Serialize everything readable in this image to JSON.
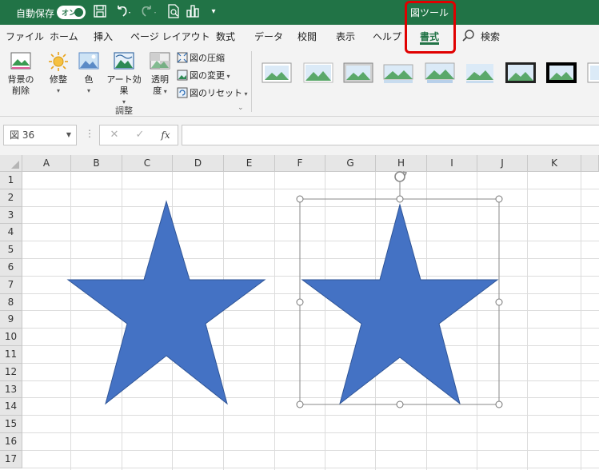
{
  "titlebar": {
    "autosave_label": "自動保存",
    "toggle_label": "オン",
    "context_tab_label": "図ツール"
  },
  "tabs": [
    {
      "label": "ファイル"
    },
    {
      "label": "ホーム"
    },
    {
      "label": "挿入"
    },
    {
      "label": "ページ レイアウト"
    },
    {
      "label": "数式"
    },
    {
      "label": "データ"
    },
    {
      "label": "校閲"
    },
    {
      "label": "表示"
    },
    {
      "label": "ヘルプ"
    },
    {
      "label": "書式"
    },
    {
      "label": "検索"
    }
  ],
  "ribbon": {
    "remove_bg_line1": "背景の",
    "remove_bg_line2": "削除",
    "corrections": "修整",
    "color": "色",
    "artistic_effects": "アート効果",
    "transparency_line1": "透明",
    "transparency_line2": "度",
    "compress": "図の圧縮",
    "change": "図の変更",
    "reset": "図のリセット",
    "group_label": "調整"
  },
  "formula_bar": {
    "name_box": "図 36",
    "cancel": "✕",
    "enter": "✓",
    "function": "fx",
    "value": ""
  },
  "grid": {
    "columns": [
      "A",
      "B",
      "C",
      "D",
      "E",
      "F",
      "G",
      "H",
      "I",
      "J",
      "K"
    ],
    "rows": [
      "1",
      "2",
      "3",
      "4",
      "5",
      "6",
      "7",
      "8",
      "9",
      "10",
      "11",
      "12",
      "13",
      "14",
      "15",
      "16",
      "17"
    ]
  },
  "colors": {
    "excel_green": "#217346",
    "star_fill": "#4472c4",
    "highlight": "#e00000"
  }
}
